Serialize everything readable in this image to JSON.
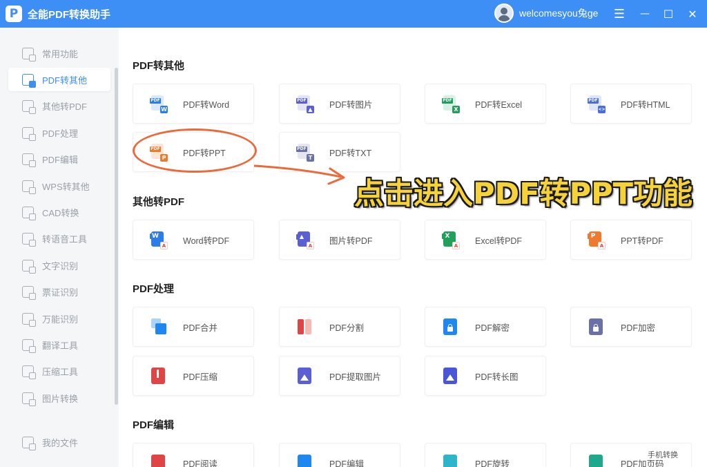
{
  "titlebar": {
    "logo_letter": "P",
    "title": "全能PDF转换助手",
    "username": "welcomesyou兔ge",
    "menu_glyph": "☰",
    "minimize_glyph": "—",
    "maximize_glyph": "☐",
    "close_glyph": "✕"
  },
  "sidebar": {
    "items": [
      {
        "label": "常用功能"
      },
      {
        "label": "PDF转其他"
      },
      {
        "label": "其他转PDF"
      },
      {
        "label": "PDF处理"
      },
      {
        "label": "PDF编辑"
      },
      {
        "label": "WPS转其他"
      },
      {
        "label": "CAD转换"
      },
      {
        "label": "转语音工具"
      },
      {
        "label": "文字识别"
      },
      {
        "label": "票证识别"
      },
      {
        "label": "万能识别"
      },
      {
        "label": "翻译工具"
      },
      {
        "label": "压缩工具"
      },
      {
        "label": "图片转换"
      }
    ],
    "active_index": 1,
    "my_files": "我的文件"
  },
  "sections": {
    "pdf_to_other": {
      "title": "PDF转其他",
      "cards": [
        {
          "label": "PDF转Word",
          "icon": "pdf-to-word-icon",
          "tag": "PDF",
          "badge": "W",
          "color": "#2b7de9"
        },
        {
          "label": "PDF转图片",
          "icon": "pdf-to-image-icon",
          "tag": "PDF",
          "badge": "▲",
          "color": "#5b5fd6"
        },
        {
          "label": "PDF转Excel",
          "icon": "pdf-to-excel-icon",
          "tag": "PDF",
          "badge": "X",
          "color": "#1fa05b"
        },
        {
          "label": "PDF转HTML",
          "icon": "pdf-to-html-icon",
          "tag": "PDF",
          "badge": "<>",
          "color": "#4a6ee0"
        },
        {
          "label": "PDF转PPT",
          "icon": "pdf-to-ppt-icon",
          "tag": "PDF",
          "badge": "P",
          "color": "#ef7a2e"
        },
        {
          "label": "PDF转TXT",
          "icon": "pdf-to-txt-icon",
          "tag": "PDF",
          "badge": "T",
          "color": "#6a70a8"
        }
      ]
    },
    "other_to_pdf": {
      "title": "其他转PDF",
      "cards": [
        {
          "label": "Word转PDF",
          "icon": "word-to-pdf-icon",
          "tag": "W",
          "color": "#2b7de9"
        },
        {
          "label": "图片转PDF",
          "icon": "image-to-pdf-icon",
          "tag": "▲",
          "color": "#5b5fd6"
        },
        {
          "label": "Excel转PDF",
          "icon": "excel-to-pdf-icon",
          "tag": "X",
          "color": "#1fa05b"
        },
        {
          "label": "PPT转PDF",
          "icon": "ppt-to-pdf-icon",
          "tag": "P",
          "color": "#ef7a2e"
        }
      ]
    },
    "pdf_process": {
      "title": "PDF处理",
      "cards": [
        {
          "label": "PDF合并",
          "icon": "pdf-merge-icon"
        },
        {
          "label": "PDF分割",
          "icon": "pdf-split-icon"
        },
        {
          "label": "PDF解密",
          "icon": "pdf-decrypt-icon"
        },
        {
          "label": "PDF加密",
          "icon": "pdf-encrypt-icon"
        },
        {
          "label": "PDF压缩",
          "icon": "pdf-compress-icon"
        },
        {
          "label": "PDF提取图片",
          "icon": "pdf-extract-image-icon"
        },
        {
          "label": "PDF转长图",
          "icon": "pdf-to-long-image-icon"
        }
      ]
    },
    "pdf_edit": {
      "title": "PDF编辑",
      "cards": [
        {
          "label": "PDF阅读"
        },
        {
          "label": "PDF编辑"
        },
        {
          "label": "PDF旋转"
        },
        {
          "label": "PDF加页码"
        }
      ]
    }
  },
  "annotation": {
    "text": "点击进入PDF转PPT功能",
    "ellipse_color": "#ea6a3b",
    "text_color": "#f5d23a"
  },
  "phone_convert": "手机转换",
  "colors": {
    "accent": "#3d8ef5",
    "sidebar_bg": "#f5f6f8"
  }
}
